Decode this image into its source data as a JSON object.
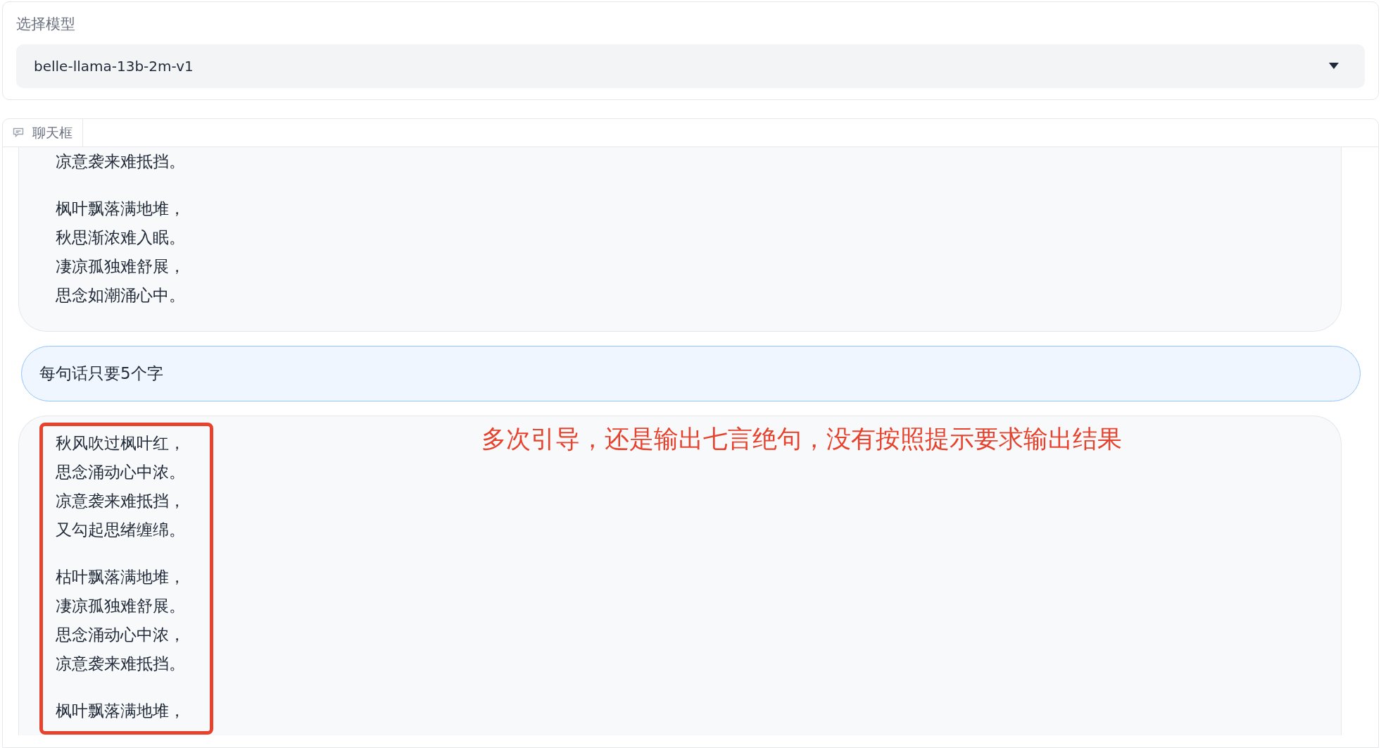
{
  "model_select": {
    "label": "选择模型",
    "value": "belle-llama-13b-2m-v1"
  },
  "chat": {
    "tab_label": "聊天框",
    "messages": [
      {
        "kind": "bot",
        "paragraphs": [
          [
            "凉意袭来难抵挡。"
          ],
          [
            "枫叶飘落满地堆，",
            "秋思渐浓难入眠。",
            "凄凉孤独难舒展，",
            "思念如潮涌心中。"
          ]
        ]
      },
      {
        "kind": "user",
        "paragraphs": [
          [
            "每句话只要5个字"
          ]
        ]
      },
      {
        "kind": "bot",
        "paragraphs": [
          [
            "秋风吹过枫叶红，",
            "思念涌动心中浓。",
            "凉意袭来难抵挡，",
            "又勾起思绪缠绵。"
          ],
          [
            "枯叶飘落满地堆，",
            "凄凉孤独难舒展。",
            "思念涌动心中浓，",
            "凉意袭来难抵挡。"
          ],
          [
            "枫叶飘落满地堆，"
          ]
        ]
      }
    ],
    "annotation": "多次引导，还是输出七言绝句，没有按照提示要求输出结果"
  }
}
